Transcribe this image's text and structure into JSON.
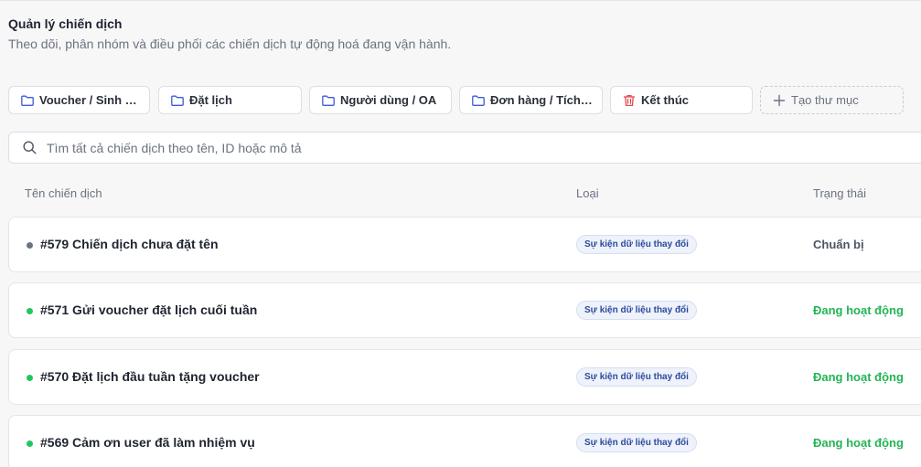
{
  "header": {
    "title": "Quản lý chiến dịch",
    "subtitle": "Theo dõi, phân nhóm và điều phối các chiến dịch tự động hoá đang vận hành."
  },
  "folders": [
    {
      "label": "Voucher / Sinh n...",
      "icon": "folder-icon"
    },
    {
      "label": "Đặt lịch",
      "icon": "folder-icon"
    },
    {
      "label": "Người dùng / OA",
      "icon": "folder-icon"
    },
    {
      "label": "Đơn hàng / Tích ...",
      "icon": "folder-icon"
    },
    {
      "label": "Kết thúc",
      "icon": "trash-icon"
    },
    {
      "label": "Tạo thư mục",
      "icon": "plus-icon"
    }
  ],
  "search": {
    "placeholder": "Tìm tất cả chiến dịch theo tên, ID hoặc mô tả",
    "value": ""
  },
  "table": {
    "columns": [
      "Tên chiến dịch",
      "Loại",
      "Trạng thái"
    ],
    "rows": [
      {
        "name": "#579 Chiến dịch chưa đặt tên",
        "type": "Sự kiện dữ liệu thay đổi",
        "status": "Chuẩn bị",
        "dot_color": "#6b7280",
        "status_color": "#4b5563"
      },
      {
        "name": "#571 Gửi voucher đặt lịch cuối tuần",
        "type": "Sự kiện dữ liệu thay đổi",
        "status": "Đang hoạt động",
        "dot_color": "#22c55e",
        "status_color": "#22b455"
      },
      {
        "name": "#570 Đặt lịch đầu tuần tặng voucher",
        "type": "Sự kiện dữ liệu thay đổi",
        "status": "Đang hoạt động",
        "dot_color": "#22c55e",
        "status_color": "#22b455"
      },
      {
        "name": "#569 Cảm ơn user đã làm nhiệm vụ",
        "type": "Sự kiện dữ liệu thay đổi",
        "status": "Đang hoạt động",
        "dot_color": "#22c55e",
        "status_color": "#22b455"
      }
    ]
  },
  "colors": {
    "danger": "#e5484d",
    "icon": "#3b5bdb"
  }
}
